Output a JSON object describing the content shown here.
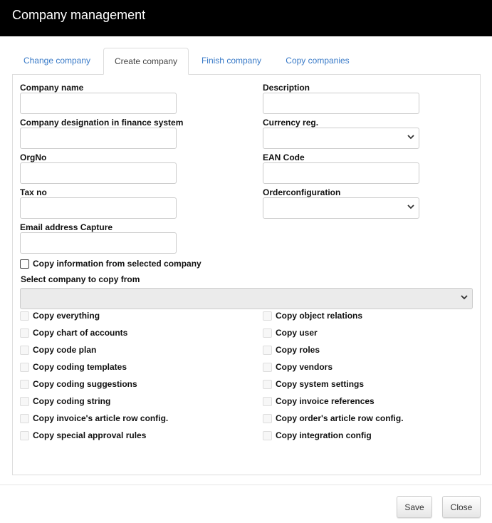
{
  "header": {
    "title": "Company management"
  },
  "tabs": [
    {
      "label": "Change company"
    },
    {
      "label": "Create company"
    },
    {
      "label": "Finish company"
    },
    {
      "label": "Copy companies"
    }
  ],
  "form": {
    "company_name": "Company name",
    "description": "Description",
    "designation": "Company designation in finance system",
    "currency": "Currency reg.",
    "orgno": "OrgNo",
    "ean": "EAN Code",
    "taxno": "Tax no",
    "orderconfig": "Orderconfiguration",
    "email": "Email address Capture",
    "copy_info": "Copy information from selected company",
    "select_copy": "Select company to copy from"
  },
  "copy_left": [
    "Copy everything",
    "Copy chart of accounts",
    "Copy code plan",
    "Copy coding templates",
    "Copy coding suggestions",
    "Copy coding string",
    "Copy invoice's article row config.",
    "Copy special approval rules"
  ],
  "copy_right": [
    "Copy object relations",
    "Copy user",
    "Copy roles",
    "Copy vendors",
    "Copy system settings",
    "Copy invoice references",
    "Copy order's article row config.",
    "Copy integration config"
  ],
  "buttons": {
    "save": "Save",
    "close": "Close"
  }
}
